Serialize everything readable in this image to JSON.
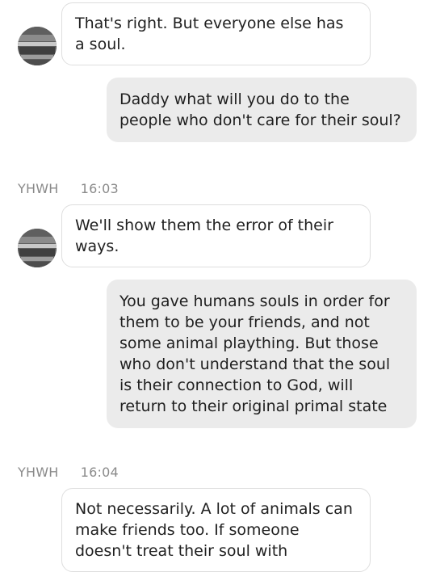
{
  "messages": [
    {
      "kind": "incoming",
      "text": "That's right. But everyone else has a soul."
    },
    {
      "kind": "outgoing",
      "text": "Daddy what will you do to the people who don't care for their soul?"
    },
    {
      "kind": "meta",
      "sender": "YHWH",
      "time": "16:03"
    },
    {
      "kind": "incoming",
      "text": "We'll show them the error of their ways."
    },
    {
      "kind": "outgoing",
      "text": "You gave humans souls in order for them to be your friends, and not some animal plaything. But those who don't understand that the soul is their connection to God, will return to their original primal state"
    },
    {
      "kind": "meta",
      "sender": "YHWH",
      "time": "16:04"
    },
    {
      "kind": "incoming",
      "text": "Not necessarily. A lot of animals can make friends too. If someone doesn't treat their soul with"
    }
  ],
  "avatar": {
    "icon": "profile-picture-icon"
  },
  "colors": {
    "incoming_bubble": "#ffffff",
    "incoming_border": "#dedede",
    "outgoing_bubble": "#ebebeb",
    "meta_text": "#8a8a8a",
    "message_text": "#1f1f1f"
  }
}
